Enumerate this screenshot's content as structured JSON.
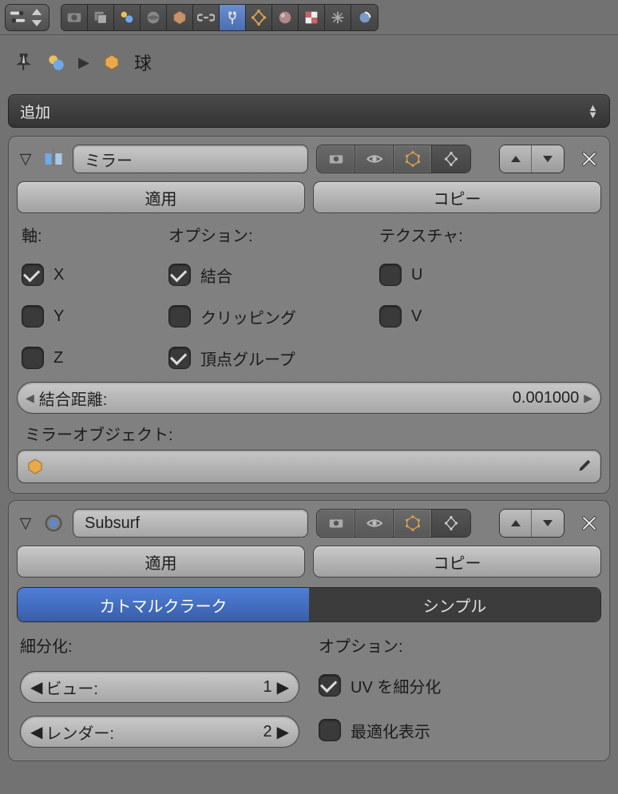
{
  "breadcrumb": {
    "object_name": "球"
  },
  "add_menu": {
    "label": "追加"
  },
  "mirror": {
    "name": "ミラー",
    "apply_label": "適用",
    "copy_label": "コピー",
    "axis_label": "軸:",
    "options_label": "オプション:",
    "texture_label": "テクスチャ:",
    "axis_x": "X",
    "axis_y": "Y",
    "axis_z": "Z",
    "merge": "結合",
    "clipping": "クリッピング",
    "vgroup": "頂点グループ",
    "tex_u": "U",
    "tex_v": "V",
    "merge_dist_label": "結合距離:",
    "merge_dist_value": "0.001000",
    "mirror_obj_label": "ミラーオブジェクト:"
  },
  "subsurf": {
    "name": "Subsurf",
    "apply_label": "適用",
    "copy_label": "コピー",
    "type_catmull": "カトマルクラーク",
    "type_simple": "シンプル",
    "subdiv_label": "細分化:",
    "options_label": "オプション:",
    "view_label": "ビュー:",
    "view_value": "1",
    "render_label": "レンダー:",
    "render_value": "2",
    "subdivide_uv": "UV を細分化",
    "optimal_display": "最適化表示"
  }
}
